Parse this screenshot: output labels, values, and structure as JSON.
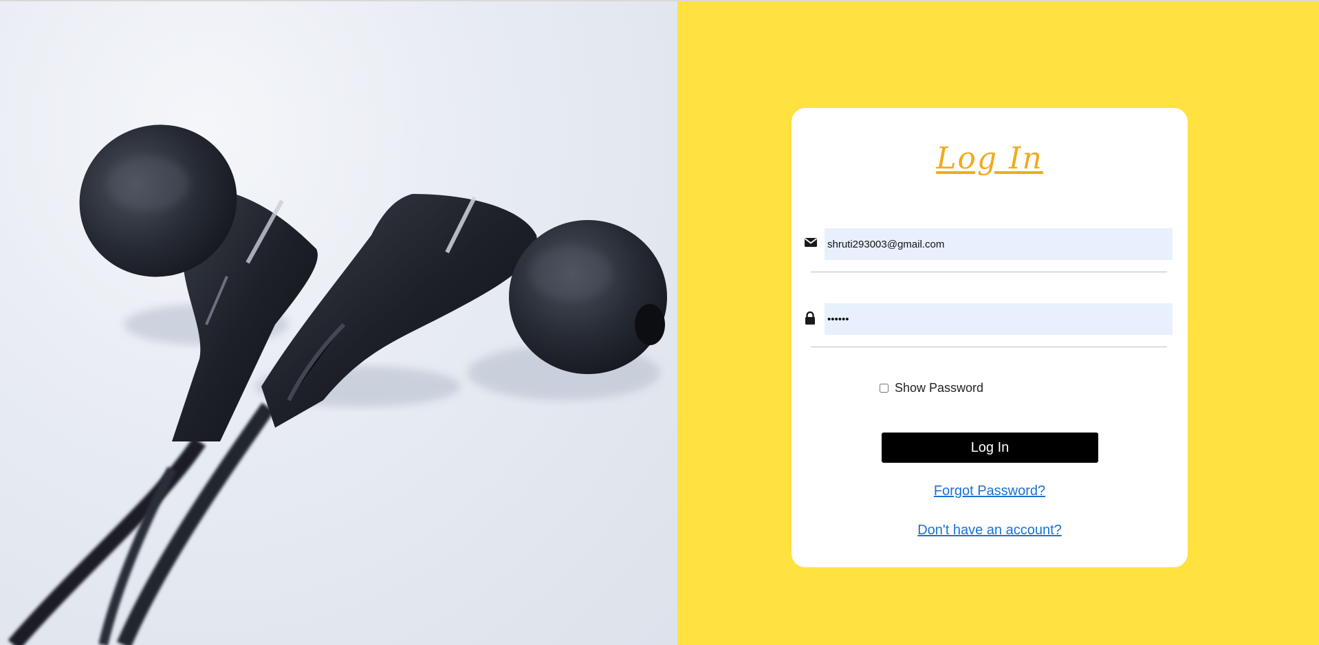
{
  "hero": {
    "image": "earphones-photo"
  },
  "login": {
    "title": "Log In",
    "email": {
      "icon": "envelope-icon",
      "value": "shruti293003@gmail.com"
    },
    "password": {
      "icon": "lock-icon",
      "value": "••••••"
    },
    "show_password_label": "Show Password",
    "submit_label": "Log In",
    "forgot_password": "Forgot Password?",
    "signup_link": "Don't have an account?"
  },
  "colors": {
    "panel_bg": "#ffe140",
    "title": "#f0ab1c",
    "button_bg": "#000000",
    "link": "#1a6fd4",
    "input_bg": "#e8f0fe"
  }
}
